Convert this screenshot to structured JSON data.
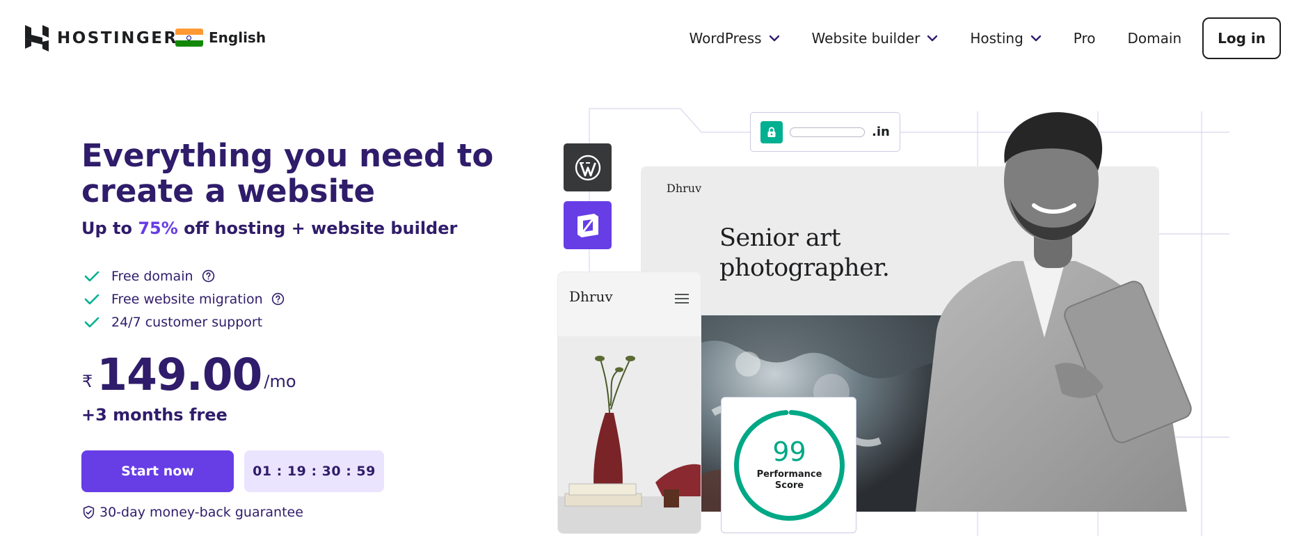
{
  "header": {
    "brand": "HOSTINGER",
    "language": "English",
    "nav": [
      {
        "label": "WordPress",
        "dropdown": true
      },
      {
        "label": "Website builder",
        "dropdown": true
      },
      {
        "label": "Hosting",
        "dropdown": true
      },
      {
        "label": "Pro",
        "dropdown": false
      },
      {
        "label": "Domain",
        "dropdown": false
      }
    ],
    "login_label": "Log in"
  },
  "hero": {
    "title": "Everything you need to create a website",
    "subtitle_prefix": "Up to ",
    "subtitle_accent": "75%",
    "subtitle_suffix": " off hosting + website builder",
    "features": [
      {
        "label": "Free domain",
        "help": true
      },
      {
        "label": "Free website migration",
        "help": true
      },
      {
        "label": "24/7 customer support",
        "help": false
      }
    ],
    "currency": "₹",
    "price": "149.00",
    "period": "/mo",
    "bonus": "+3 months free",
    "cta_label": "Start now",
    "countdown": "01 : 19 : 30 : 59",
    "guarantee": "30-day money-back guarantee"
  },
  "illustration": {
    "url_tld": ".in",
    "site_brand": "Dhruv",
    "site_headline_line1": "Senior art",
    "site_headline_line2": "photographer.",
    "phone_brand": "Dhruv",
    "performance_score": "99",
    "performance_label_line1": "Performance",
    "performance_label_line2": "Score"
  },
  "colors": {
    "primary": "#673de6",
    "text_dark": "#2f1c6a",
    "success": "#00b090",
    "timer_bg": "#ebe4ff"
  }
}
